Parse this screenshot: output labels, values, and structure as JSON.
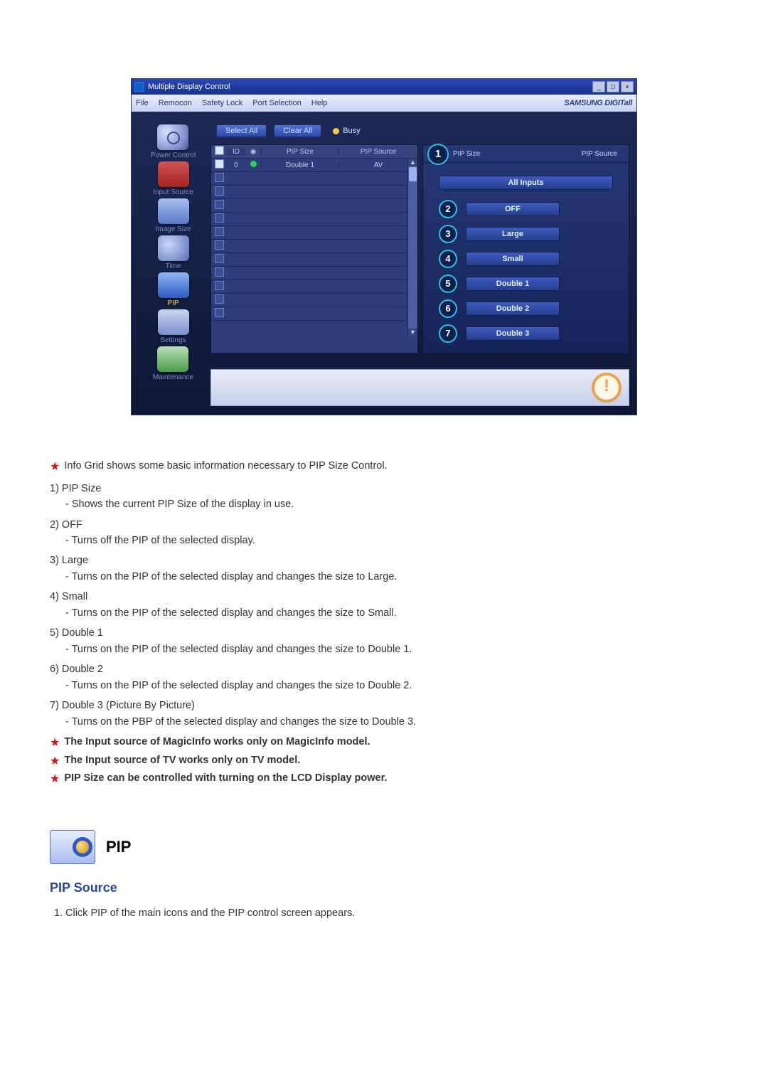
{
  "window": {
    "title": "Multiple Display Control",
    "brand": "SAMSUNG DIGITall"
  },
  "menu": {
    "file": "File",
    "remocon": "Remocon",
    "safety": "Safety Lock",
    "port": "Port Selection",
    "help": "Help"
  },
  "sidebar": {
    "power": "Power Control",
    "input": "Input Source",
    "image": "Image Size",
    "time": "Time",
    "pip": "PIP",
    "settings": "Settings",
    "maint": "Maintenance"
  },
  "toolbar": {
    "select_all": "Select All",
    "clear_all": "Clear All",
    "busy": "Busy"
  },
  "grid": {
    "hdr_id": "ID",
    "hdr_size": "PIP Size",
    "hdr_src": "PIP Source",
    "rows": [
      {
        "checked": true,
        "id": "0",
        "lamp": "green",
        "size": "Double 1",
        "src": "AV"
      },
      {
        "checked": false,
        "id": "",
        "lamp": "",
        "size": "",
        "src": ""
      },
      {
        "checked": false,
        "id": "",
        "lamp": "",
        "size": "",
        "src": ""
      },
      {
        "checked": false,
        "id": "",
        "lamp": "",
        "size": "",
        "src": ""
      },
      {
        "checked": false,
        "id": "",
        "lamp": "",
        "size": "",
        "src": ""
      },
      {
        "checked": false,
        "id": "",
        "lamp": "",
        "size": "",
        "src": ""
      },
      {
        "checked": false,
        "id": "",
        "lamp": "",
        "size": "",
        "src": ""
      },
      {
        "checked": false,
        "id": "",
        "lamp": "",
        "size": "",
        "src": ""
      },
      {
        "checked": false,
        "id": "",
        "lamp": "",
        "size": "",
        "src": ""
      },
      {
        "checked": false,
        "id": "",
        "lamp": "",
        "size": "",
        "src": ""
      },
      {
        "checked": false,
        "id": "",
        "lamp": "",
        "size": "",
        "src": ""
      },
      {
        "checked": false,
        "id": "",
        "lamp": "",
        "size": "",
        "src": ""
      }
    ]
  },
  "panel": {
    "head_badge": "1",
    "head_size": "PIP Size",
    "head_src": "PIP Source",
    "all_inputs": "All Inputs",
    "opts": [
      {
        "n": "2",
        "label": "OFF"
      },
      {
        "n": "3",
        "label": "Large"
      },
      {
        "n": "4",
        "label": "Small"
      },
      {
        "n": "5",
        "label": "Double 1"
      },
      {
        "n": "6",
        "label": "Double 2"
      },
      {
        "n": "7",
        "label": "Double 3"
      }
    ]
  },
  "doc": {
    "intro": "Info Grid shows some basic information necessary to PIP Size Control.",
    "items": [
      {
        "t": "1)  PIP Size",
        "d": "- Shows the current PIP Size of the display in use."
      },
      {
        "t": "2)  OFF",
        "d": "- Turns off the PIP of the selected display."
      },
      {
        "t": "3)  Large",
        "d": "- Turns on the PIP of the selected display and changes the size to Large."
      },
      {
        "t": "4)  Small",
        "d": "- Turns on the PIP of the selected display and changes the size to Small."
      },
      {
        "t": "5)  Double 1",
        "d": "- Turns on the PIP of the selected display and changes the size to Double 1."
      },
      {
        "t": "6)  Double 2",
        "d": "- Turns on the PIP of the selected display and changes the size to Double 2."
      },
      {
        "t": "7)  Double 3 (Picture By Picture)",
        "d": "- Turns on the PBP of the selected display and changes the size to Double 3."
      }
    ],
    "notes": [
      "The Input source of MagicInfo works only on MagicInfo model.",
      "The Input source of TV works only on TV model.",
      "PIP Size can be controlled with turning on the LCD Display power."
    ],
    "section_title": "PIP",
    "h3": "PIP Source",
    "step1": "Click PIP of the main icons and the PIP control screen appears."
  }
}
